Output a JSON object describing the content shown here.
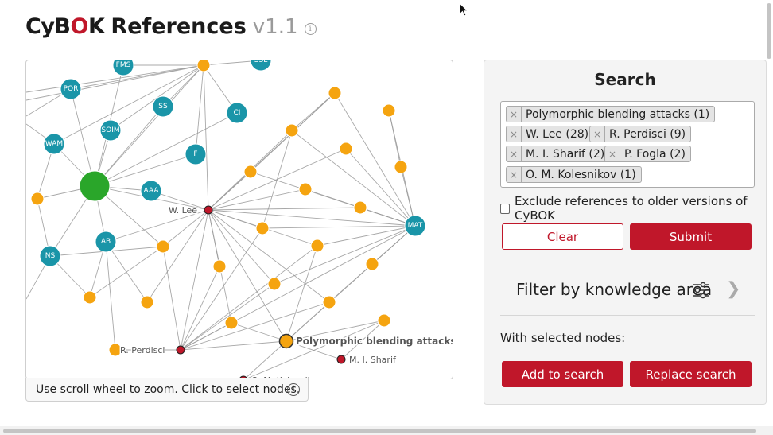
{
  "header": {
    "logo_prefix": "CyB",
    "logo_o": "O",
    "logo_suffix": "K",
    "title": "References",
    "version": "v1.1",
    "info_glyph": "i"
  },
  "graph": {
    "labels": {
      "w_lee": "W. Lee",
      "r_perdisci": "R. Perdisci",
      "m_i_sharif": "M. I. Sharif",
      "o_m_kolesnikov": "O. M. Kolesnikov",
      "poly": "Polymorphic blending attacks"
    },
    "ka_nodes": [
      "FMS",
      "SSL",
      "POR",
      "SS",
      "CI",
      "SOIM",
      "WAM",
      "F",
      "AAA",
      "AB",
      "NS",
      "MAT"
    ],
    "colors": {
      "ka_node": "#1a95a8",
      "ref_node": "#f5a410",
      "author_node": "#c0172a",
      "big_node": "#2aa62a",
      "edge": "#999999"
    }
  },
  "hint": {
    "text": "Use scroll wheel to zoom. Click to select nodes.",
    "info_glyph": "i"
  },
  "search": {
    "title": "Search",
    "tags": [
      "Polymorphic blending attacks (1)",
      "W. Lee (28)",
      "R. Perdisci (9)",
      "M. I. Sharif (2)",
      "P. Fogla (2)",
      "O. M. Kolesnikov (1)"
    ],
    "remove_glyph": "×",
    "exclude_label": "Exclude references to older versions of CyBOK",
    "clear_label": "Clear",
    "submit_label": "Submit",
    "filter_label": "Filter by knowledge area",
    "chevron_glyph": "❯",
    "with_selected_label": "With selected nodes:",
    "add_label": "Add to search",
    "replace_label": "Replace search"
  },
  "icons": {
    "info": "info-icon",
    "filter": "sliders-icon",
    "chevron": "chevron-right-icon",
    "remove": "close-icon",
    "cursor": "mouse-pointer-icon"
  }
}
